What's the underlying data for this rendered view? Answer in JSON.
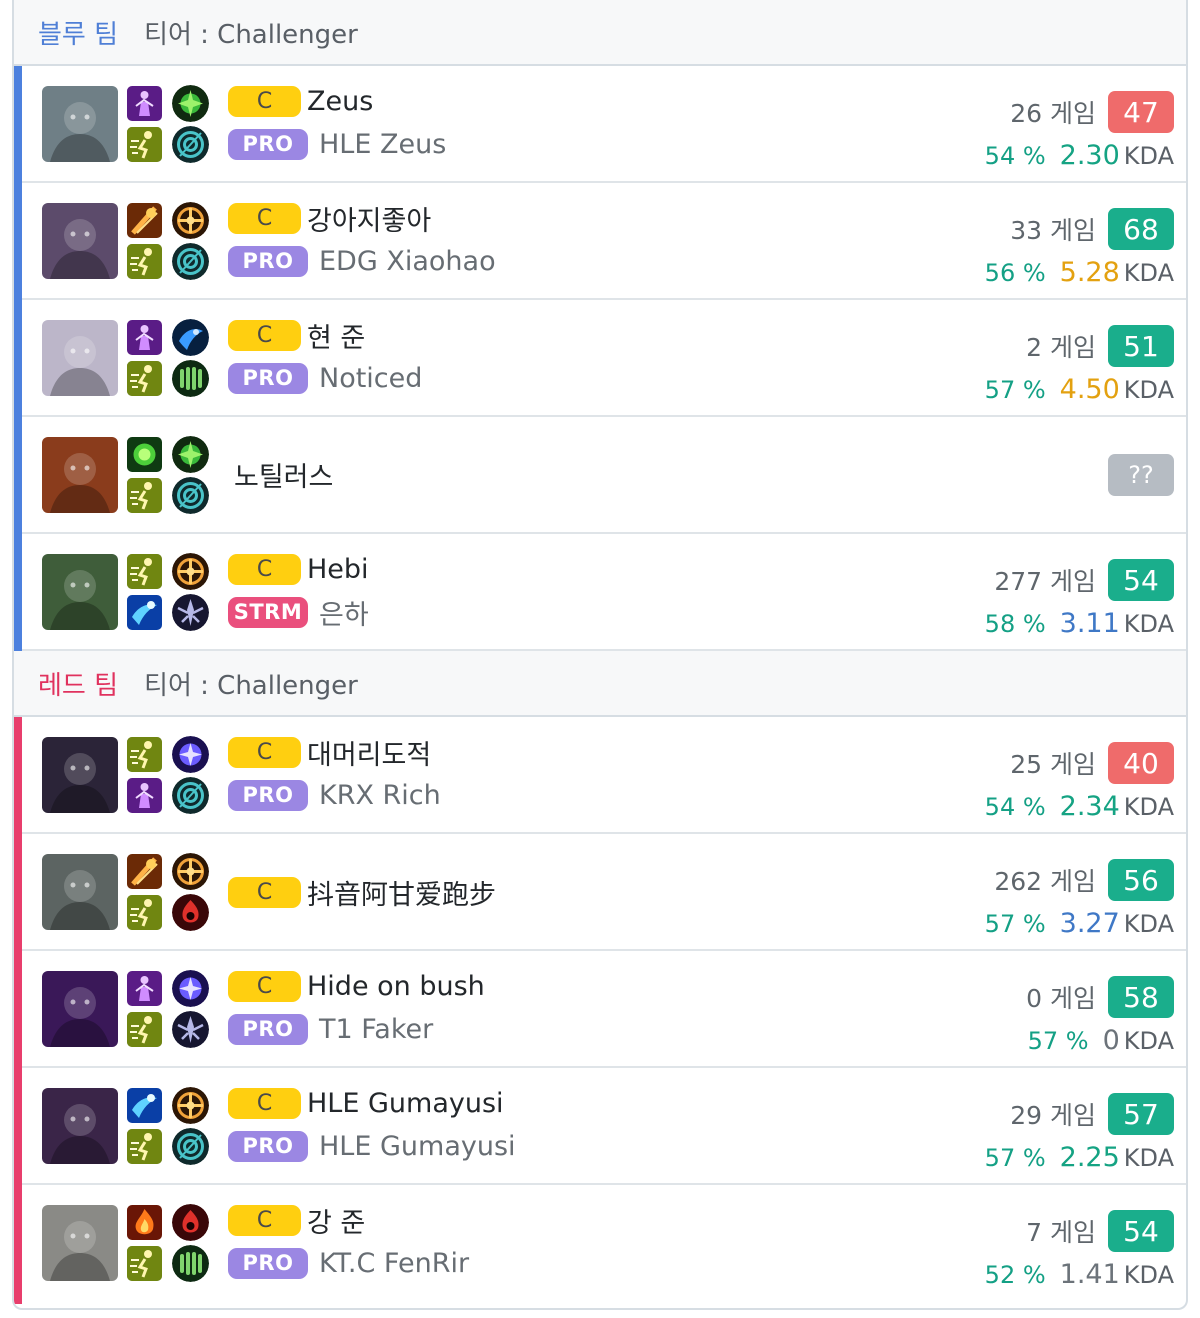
{
  "blue_team": {
    "label": "블루 팀",
    "tier": "티어 : Challenger",
    "players": [
      {
        "summoner": "Zeus",
        "rank_badge": "C",
        "tag": "PRO",
        "tag_type": "pro",
        "pro_name": "HLE Zeus",
        "games": "26 게임",
        "score": "47",
        "score_color": "red",
        "winrate": "54 %",
        "kda": "2.30",
        "kda_color": "teal",
        "kda_label": "KDA",
        "champion_icon": "champion-portrait-icon",
        "champ_color": "#6f7f86",
        "spells": [
          "purple-spell-icon",
          "ghost-spell-icon"
        ],
        "runes": [
          "green-rune-icon",
          "inspiration-rune-icon"
        ]
      },
      {
        "summoner": "강아지좋아",
        "rank_badge": "C",
        "tag": "PRO",
        "tag_type": "pro",
        "pro_name": "EDG Xiaohao",
        "games": "33 게임",
        "score": "68",
        "score_color": "green",
        "winrate": "56 %",
        "kda": "5.28",
        "kda_color": "orange",
        "kda_label": "KDA",
        "champion_icon": "champion-portrait-icon",
        "champ_color": "#5c4b6b",
        "spells": [
          "smite-spell-icon",
          "ghost-spell-icon"
        ],
        "runes": [
          "precision-rune-icon",
          "inspiration-rune-icon"
        ]
      },
      {
        "summoner": "현 준",
        "rank_badge": "C",
        "tag": "PRO",
        "tag_type": "pro",
        "pro_name": "Noticed",
        "games": "2 게임",
        "score": "51",
        "score_color": "green",
        "winrate": "57 %",
        "kda": "4.50",
        "kda_color": "orange",
        "kda_label": "KDA",
        "champion_icon": "champion-portrait-icon",
        "champ_color": "#bcb6c9",
        "spells": [
          "purple-spell-icon",
          "ghost-spell-icon"
        ],
        "runes": [
          "blue-rune-icon",
          "resolve-rune-icon"
        ]
      },
      {
        "summoner": "노틸러스",
        "rank_badge": "",
        "tag": "",
        "tag_type": "",
        "pro_name": "",
        "games": "",
        "score": "??",
        "score_color": "grey",
        "winrate": "",
        "kda": "",
        "kda_color": "",
        "kda_label": "",
        "champion_icon": "champion-portrait-icon",
        "champ_color": "#8a3c1c",
        "spells": [
          "heal-spell-icon",
          "ghost-spell-icon"
        ],
        "runes": [
          "green-rune-icon",
          "inspiration-rune-icon"
        ]
      },
      {
        "summoner": "Hebi",
        "rank_badge": "C",
        "tag": "STRM",
        "tag_type": "strm",
        "pro_name": "은하",
        "games": "277 게임",
        "score": "54",
        "score_color": "green",
        "winrate": "58 %",
        "kda": "3.11",
        "kda_color": "blue",
        "kda_label": "KDA",
        "champion_icon": "champion-portrait-icon",
        "champ_color": "#3f5d3a",
        "spells": [
          "ghost-spell-icon",
          "flash-spell-icon"
        ],
        "runes": [
          "precision-rune-icon",
          "domination-rune-icon"
        ]
      }
    ]
  },
  "red_team": {
    "label": "레드 팀",
    "tier": "티어 : Challenger",
    "players": [
      {
        "summoner": "대머리도적",
        "rank_badge": "C",
        "tag": "PRO",
        "tag_type": "pro",
        "pro_name": "KRX Rich",
        "games": "25 게임",
        "score": "40",
        "score_color": "red",
        "winrate": "54 %",
        "kda": "2.34",
        "kda_color": "teal",
        "kda_label": "KDA",
        "champion_icon": "champion-portrait-icon",
        "champ_color": "#2b2438",
        "spells": [
          "ghost-spell-icon",
          "purple-spell-icon"
        ],
        "runes": [
          "sorcery-rune-icon",
          "inspiration-rune-icon"
        ]
      },
      {
        "summoner": "抖音阿甘爱跑步",
        "rank_badge": "C",
        "tag": "",
        "tag_type": "",
        "pro_name": "",
        "games": "262 게임",
        "score": "56",
        "score_color": "green",
        "winrate": "57 %",
        "kda": "3.27",
        "kda_color": "blue",
        "kda_label": "KDA",
        "champion_icon": "champion-portrait-icon",
        "champ_color": "#5c6462",
        "spells": [
          "smite-spell-icon",
          "ghost-spell-icon"
        ],
        "runes": [
          "precision-rune-icon",
          "red-rune-icon"
        ]
      },
      {
        "summoner": "Hide on bush",
        "rank_badge": "C",
        "tag": "PRO",
        "tag_type": "pro",
        "pro_name": "T1 Faker",
        "games": "0 게임",
        "score": "58",
        "score_color": "green",
        "winrate": "57 %",
        "kda": "0",
        "kda_color": "grey",
        "kda_label": "KDA",
        "champion_icon": "champion-portrait-icon",
        "champ_color": "#3a1858",
        "spells": [
          "purple-spell-icon",
          "ghost-spell-icon"
        ],
        "runes": [
          "sorcery-rune-icon",
          "domination-rune-icon"
        ]
      },
      {
        "summoner": "HLE Gumayusi",
        "rank_badge": "C",
        "tag": "PRO",
        "tag_type": "pro",
        "pro_name": "HLE Gumayusi",
        "games": "29 게임",
        "score": "57",
        "score_color": "green",
        "winrate": "57 %",
        "kda": "2.25",
        "kda_color": "teal",
        "kda_label": "KDA",
        "champion_icon": "champion-portrait-icon",
        "champ_color": "#3a2548",
        "spells": [
          "flash-spell-icon",
          "ghost-spell-icon"
        ],
        "runes": [
          "precision-rune-icon",
          "inspiration-rune-icon"
        ]
      },
      {
        "summoner": "강 준",
        "rank_badge": "C",
        "tag": "PRO",
        "tag_type": "pro",
        "pro_name": "KT.C FenRir",
        "games": "7 게임",
        "score": "54",
        "score_color": "green",
        "winrate": "52 %",
        "kda": "1.41",
        "kda_color": "grey",
        "kda_label": "KDA",
        "champion_icon": "champion-portrait-icon",
        "champ_color": "#8a8a86",
        "spells": [
          "ignite-spell-icon",
          "ghost-spell-icon"
        ],
        "runes": [
          "red-rune-icon",
          "resolve-rune-icon"
        ]
      }
    ]
  },
  "colors": {
    "blue_team": "#4c80de",
    "red_team": "#e83e6c",
    "score_green": "#1aae8c",
    "score_red": "#ef6b6b",
    "score_grey": "#b6bcc3",
    "rank_badge": "#ffcf10",
    "pro_badge": "#9b87e3",
    "strm_badge": "#ea4f7d"
  }
}
